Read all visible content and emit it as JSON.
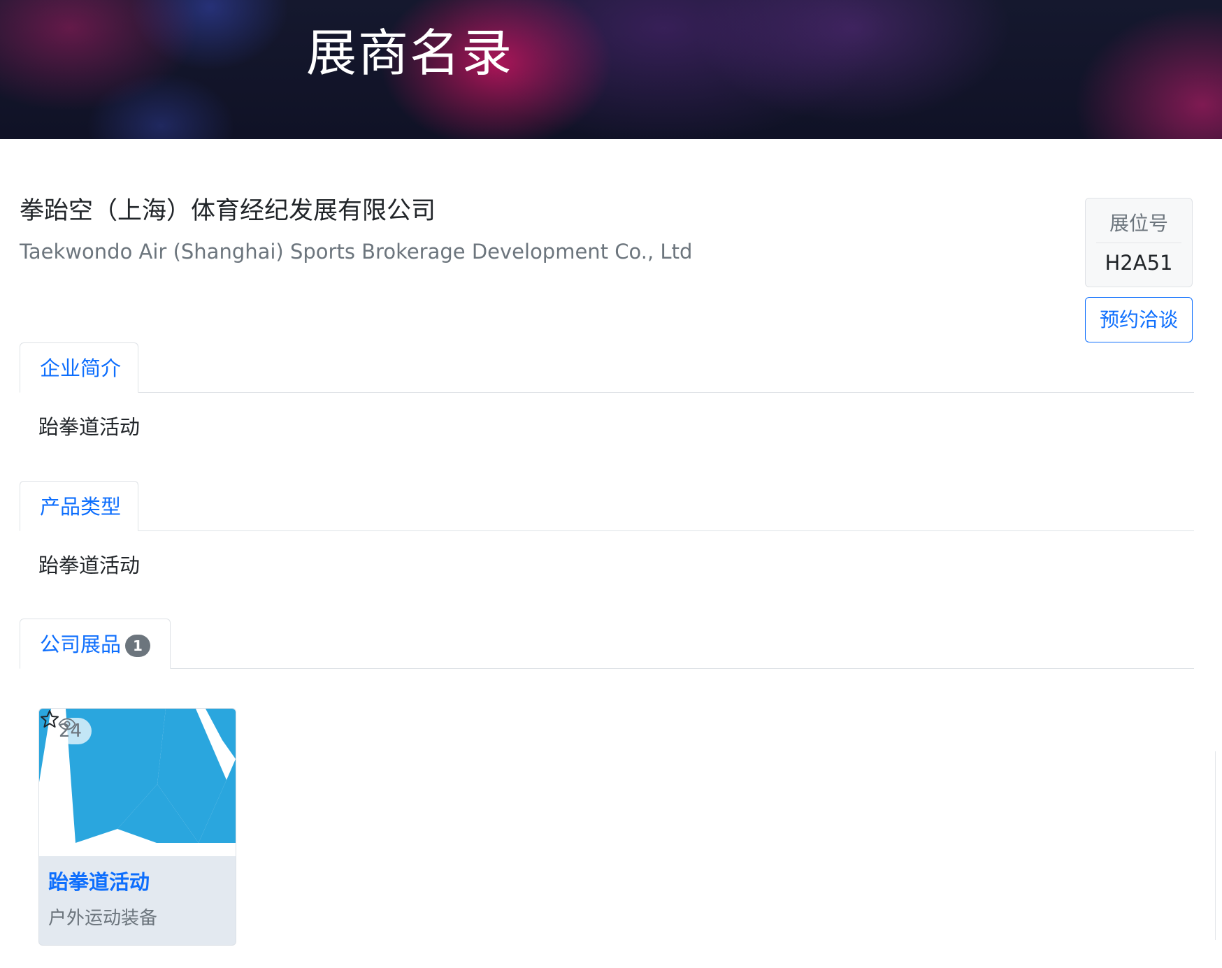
{
  "banner": {
    "title": "展商名录"
  },
  "exhibitor": {
    "name_cn": "拳跆空（上海）体育经纪发展有限公司",
    "name_en": "Taekwondo Air (Shanghai) Sports Brokerage Development Co., Ltd",
    "booth_label": "展位号",
    "booth_number": "H2A51",
    "meet_button_label": "预约洽谈"
  },
  "sections": {
    "profile": {
      "tab_label": "企业简介",
      "content": "跆拳道活动"
    },
    "product_type": {
      "tab_label": "产品类型",
      "content": "跆拳道活动"
    },
    "products": {
      "tab_label": "公司展品",
      "count": "1"
    }
  },
  "products": [
    {
      "name": "跆拳道活动",
      "category": "户外运动装备",
      "views": "24",
      "icons": {
        "views": "eye-icon",
        "favorite": "star-icon"
      }
    }
  ],
  "colors": {
    "accent": "#0d6efd",
    "muted_text": "#6c757d",
    "badge": "#6c757d",
    "product_image_blue": "#2aa6de",
    "card_footer": "#e3e9f0"
  }
}
